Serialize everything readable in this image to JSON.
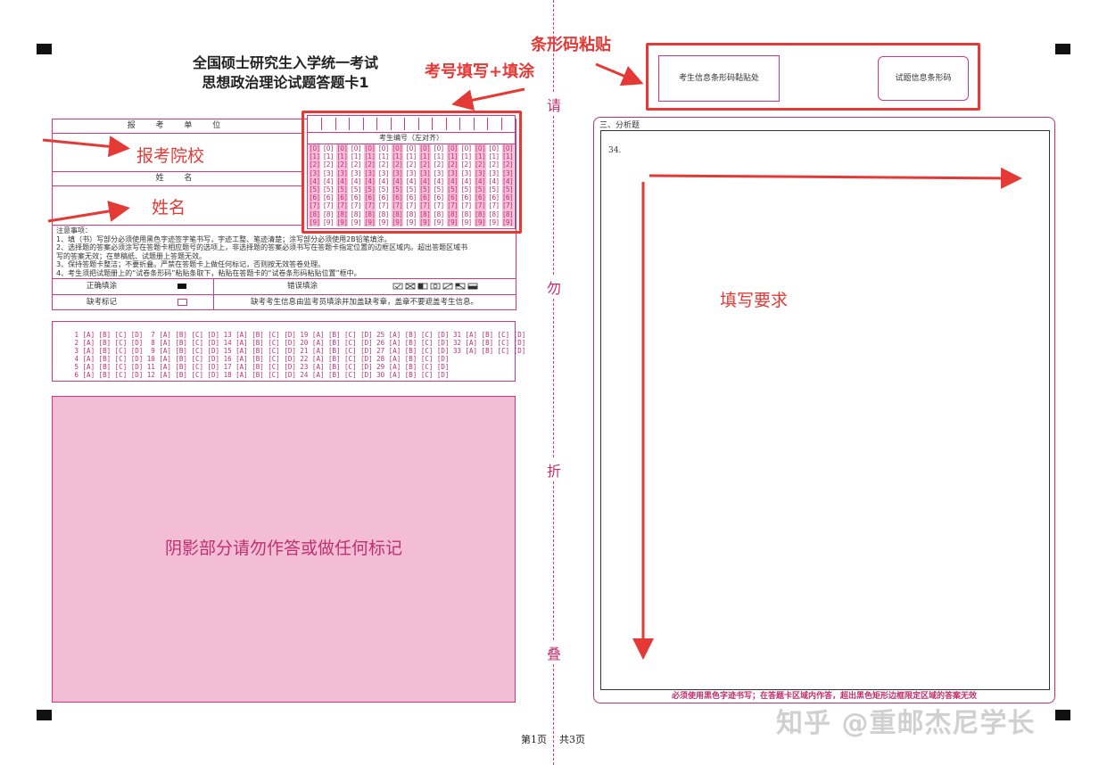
{
  "title": {
    "line1": "全国硕士研究生入学统一考试",
    "line2": "思想政治理论试题答题卡1"
  },
  "info_table": {
    "unit_label": "报 考 单 位",
    "name_label": "姓   名",
    "notes": [
      "注意事项：",
      "1、填（书）写部分必须使用黑色字迹签字笔书写，字迹工整、笔迹清楚；涂写部分必须使用2B铅笔填涂。",
      "2、选择题的答案必须涂写在答题卡相应题号的选项上，非选择题的答案必须书写在答题卡指定位置的边框区域内。超出答题区域书",
      "    写的答案无效；在草稿纸、试题册上答题无效。",
      "3、保持答题卡整洁；不要折叠。严禁在答题卡上做任何标记，否则按无效答卷处理。",
      "4、考生须把试题册上的“试卷条形码”粘贴条取下，粘贴在答题卡的“试卷条形码粘贴位置”框中。"
    ],
    "correct_fill_label": "正确填涂",
    "wrong_fill_label": "错误填涂",
    "absent_label": "缺考标记",
    "absent_note": "缺考考生信息由监考员填涂并加盖缺考章，盖章不要遮盖考生信息。"
  },
  "exam_id": {
    "header": "考生编号（左对齐）",
    "digits": [
      "0",
      "1",
      "2",
      "3",
      "4",
      "5",
      "6",
      "7",
      "8",
      "9"
    ],
    "columns": 15
  },
  "mcq": {
    "lines": [
      " 1 [A] [B] [C] [D]  7 [A] [B] [C] [D] 13 [A] [B] [C] [D] 19 [A] [B] [C] [D] 25 [A] [B] [C] [D] 31 [A] [B] [C] [D]",
      " 2 [A] [B] [C] [D]  8 [A] [B] [C] [D] 14 [A] [B] [C] [D] 20 [A] [B] [C] [D] 26 [A] [B] [C] [D] 32 [A] [B] [C] [D]",
      " 3 [A] [B] [C] [D]  9 [A] [B] [C] [D] 15 [A] [B] [C] [D] 21 [A] [B] [C] [D] 27 [A] [B] [C] [D] 33 [A] [B] [C] [D]",
      " 4 [A] [B] [C] [D] 10 [A] [B] [C] [D] 16 [A] [B] [C] [D] 22 [A] [B] [C] [D] 28 [A] [B] [C] [D]",
      " 5 [A] [B] [C] [D] 11 [A] [B] [C] [D] 17 [A] [B] [C] [D] 23 [A] [B] [C] [D] 29 [A] [B] [C] [D]",
      " 6 [A] [B] [C] [D] 12 [A] [B] [C] [D] 18 [A] [B] [C] [D] 24 [A] [B] [C] [D] 30 [A] [B] [C] [D]"
    ]
  },
  "shaded_text": "阴影部分请勿作答或做任何标记",
  "fold_chars": [
    "请",
    "勿",
    "折",
    "叠"
  ],
  "barcode": {
    "candidate_label": "考生信息条形码黏贴处",
    "exam_label": "试题信息条形码"
  },
  "analysis": {
    "section_title": "三、分析题",
    "question_number": "34.",
    "footnote": "必须使用黑色字迹书写；在答题卡区域内作答，超出黑色矩形边框限定区域的答案无效"
  },
  "annotations": {
    "barcode": "条形码粘贴",
    "exam_id": "考号填写+填涂",
    "school": "报考院校",
    "name": "姓名",
    "writing": "填写要求"
  },
  "page_footer": "第1页    共3页",
  "watermark": "知乎 @重邮杰尼学长",
  "colors": {
    "pink": "#d4377f",
    "shade": "#f4bdd6",
    "annotation_red": "#e53935"
  }
}
